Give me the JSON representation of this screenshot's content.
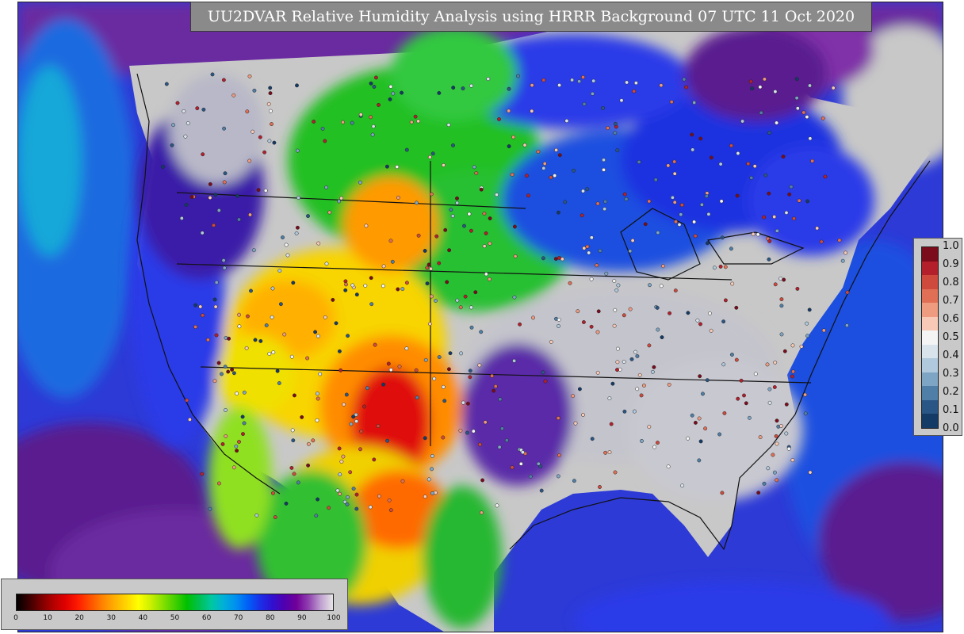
{
  "title": "UU2DVAR Relative Humidity Analysis using HRRR Background 07 UTC 11 Oct 2020",
  "colorbars": {
    "right": {
      "ticks": [
        "1.0",
        "0.9",
        "0.8",
        "0.7",
        "0.6",
        "0.5",
        "0.4",
        "0.3",
        "0.2",
        "0.1",
        "0.0"
      ],
      "colors": [
        "#7a0c1c",
        "#b41f2c",
        "#cf4a3c",
        "#e06f55",
        "#ee9b80",
        "#f7c9b6",
        "#f4f4f4",
        "#d9e3ec",
        "#b0c9dd",
        "#7ea6c4",
        "#4f7fa7",
        "#2a5685",
        "#143a66"
      ]
    },
    "bottom": {
      "ticks": [
        "0",
        "10",
        "20",
        "30",
        "40",
        "50",
        "60",
        "70",
        "80",
        "90",
        "100"
      ],
      "colors": [
        "#000000",
        "#3a0000",
        "#7a0000",
        "#b40000",
        "#e00000",
        "#ff1a00",
        "#ff4d00",
        "#ff8000",
        "#ffad00",
        "#ffd400",
        "#ffff00",
        "#ccf000",
        "#88e000",
        "#44d000",
        "#00c000",
        "#00c050",
        "#00c8a0",
        "#00b0d8",
        "#0090f0",
        "#0060f8",
        "#1a30e8",
        "#3010d0",
        "#5000b0",
        "#700098",
        "#9040b0",
        "#c0a0d0",
        "#e6e6e6"
      ]
    }
  },
  "colors": {
    "ocean_purple": "#5a1d8f",
    "ocean_blue": "#1a2ee0",
    "land_gray": "#c8c8c8",
    "dry_red": "#e01010",
    "dry_orange": "#ff8c00",
    "mid_yellow": "#f8e000",
    "mid_green": "#22c21a",
    "moist_cyan": "#00a8d8",
    "moist_blue": "#1030e0"
  }
}
